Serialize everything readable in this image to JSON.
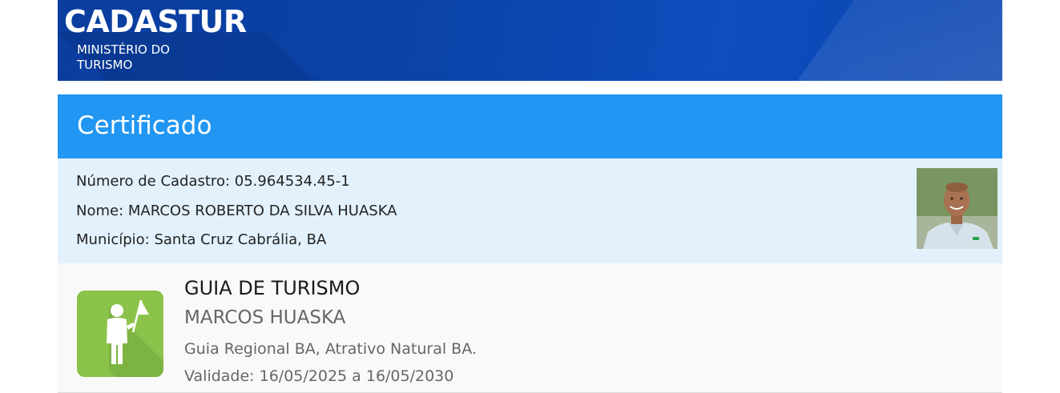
{
  "header": {
    "brand": "CADASTUR",
    "subtitle_line1": "MINISTÉRIO DO",
    "subtitle_line2": "TURISMO",
    "colors": {
      "banner": "#0b43a8"
    }
  },
  "certificate": {
    "title": "Certificado",
    "colors": {
      "bar": "#2196f3",
      "info_bg": "#e3f1fd"
    }
  },
  "info": {
    "registration": "Número de Cadastro: 05.964534.45-1",
    "name": "Nome: MARCOS ROBERTO DA SILVA HUASKA",
    "municipality": "Município: Santa Cruz Cabrália, BA",
    "photo_icon": "person-photo"
  },
  "category": {
    "icon": "tour-guide-flag-icon",
    "title": "GUIA DE TURISMO",
    "name": "MARCOS HUASKA",
    "description": "Guia Regional BA, Atrativo Natural BA.",
    "validity": "Validade: 16/05/2025 a 16/05/2030",
    "colors": {
      "icon_bg": "#8bc34a"
    }
  }
}
